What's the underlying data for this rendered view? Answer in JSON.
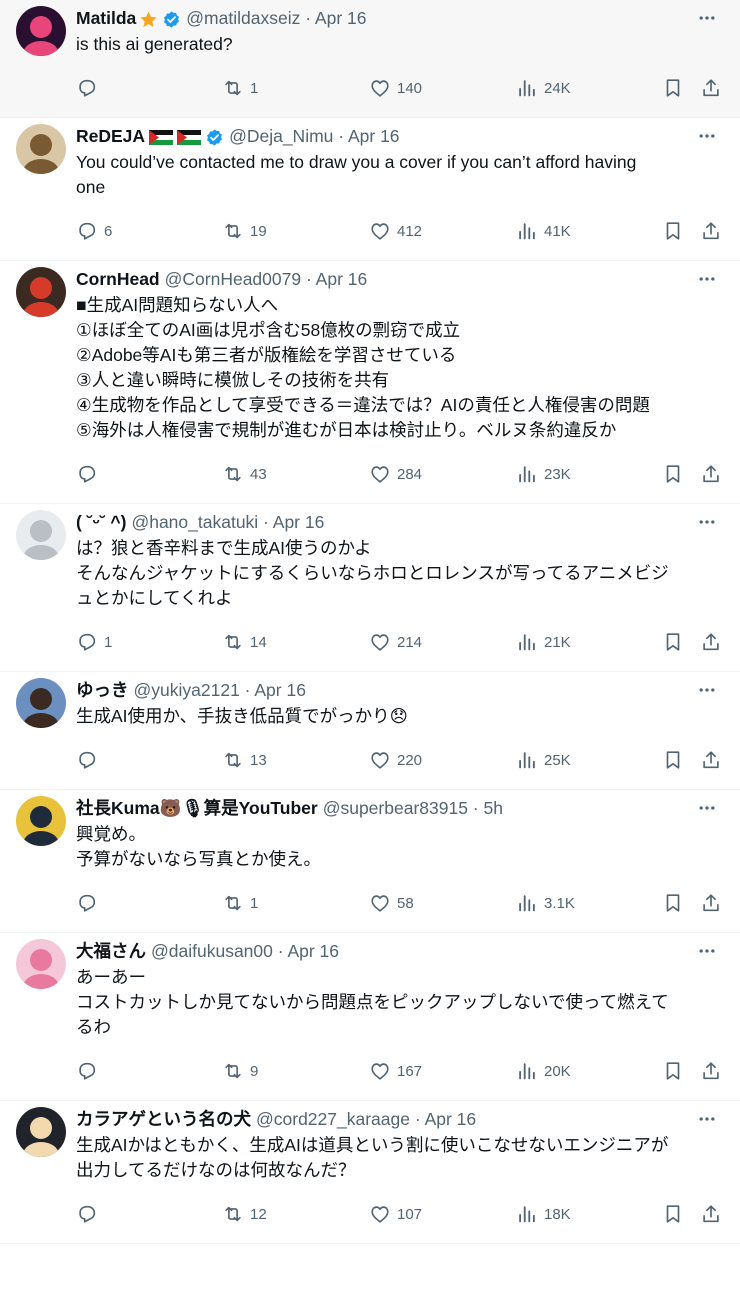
{
  "tweets": [
    {
      "name": "Matilda",
      "handle": "@matildaxseiz · Apr 16",
      "text": "is this ai generated?",
      "replies": "",
      "reposts": "1",
      "likes": "140",
      "views": "24K",
      "verified": true,
      "emoji": "star",
      "highlight": true,
      "avatar": {
        "bg": "#2a1030",
        "fg": "#e8467a"
      }
    },
    {
      "name": "ReDEJA",
      "handle": "@Deja_Nimu · Apr 16",
      "text": "You could’ve contacted me to draw you a cover if you can’t afford having\none",
      "replies": "6",
      "reposts": "19",
      "likes": "412",
      "views": "41K",
      "verified": true,
      "flags": [
        "palestine-flag",
        "sudan-flag"
      ],
      "avatar": {
        "bg": "#d8c6a4",
        "fg": "#7a5a33"
      }
    },
    {
      "name": "CornHead",
      "handle": "@CornHead0079 · Apr 16",
      "text": "■生成AI問題知らない人へ\n①ほぼ全てのAI画は児ポ含む58億枚の剽窃で成立\n②Adobe等AIも第三者が版権絵を学習させている\n③人と違い瞬時に模倣しその技術を共有\n④生成物を作品として享受できる＝違法では？AIの責任と人権侵害の問題\n⑤海外は人権侵害で規制が進むが日本は検討止り。ベルヌ条約違反か",
      "replies": "",
      "reposts": "43",
      "likes": "284",
      "views": "23K",
      "avatar": {
        "bg": "#3a2a22",
        "fg": "#d63a2a"
      }
    },
    {
      "name": "( ˘ᵕ˘ ^)",
      "handle": "@hano_takatuki · Apr 16",
      "text": "は？狼と香辛料まで生成AI使うのかよ\nそんなんジャケットにするくらいならホロとロレンスが写ってるアニメビジ\nュとかにしてくれよ",
      "replies": "1",
      "reposts": "14",
      "likes": "214",
      "views": "21K",
      "avatar": {
        "bg": "#e9ecee",
        "fg": "#b9bfc4"
      }
    },
    {
      "name": "ゆっき",
      "handle": "@yukiya2121 · Apr 16",
      "text": "生成AI使用か、手抜き低品質でがっかり😞",
      "replies": "",
      "reposts": "13",
      "likes": "220",
      "views": "25K",
      "avatar": {
        "bg": "#6b8fbf",
        "fg": "#3a2a22"
      }
    },
    {
      "name": "社長Kuma🐻🎙算是YouTuber",
      "handle": "@superbear83915 · 5h",
      "text": "興覚め。\n予算がないなら写真とか使え。",
      "replies": "",
      "reposts": "1",
      "likes": "58",
      "views": "3.1K",
      "avatar": {
        "bg": "#e7c23a",
        "fg": "#1f2b3a"
      }
    },
    {
      "name": "大福さん",
      "handle": "@daifukusan00 · Apr 16",
      "text": "あーあー\nコストカットしか見てないから問題点をピックアップしないで使って燃えて\nるわ",
      "replies": "",
      "reposts": "9",
      "likes": "167",
      "views": "20K",
      "avatar": {
        "bg": "#f4c8d8",
        "fg": "#e87aa0"
      }
    },
    {
      "name": "カラアゲという名の犬",
      "handle": "@cord227_karaage · Apr 16",
      "text": "生成AIかはともかく、生成AIは道具という割に使いこなせないエンジニアが\n出力してるだけなのは何故なんだ？",
      "replies": "",
      "reposts": "12",
      "likes": "107",
      "views": "18K",
      "avatar": {
        "bg": "#20242a",
        "fg": "#f2d9b0"
      }
    }
  ],
  "colors": {
    "text": "#0f1419",
    "secondary": "#536471",
    "verified": "#1d9bf0",
    "border": "#eff3f4",
    "highlight": "#f7f7f7",
    "star": "#f5a623"
  },
  "icons": [
    "reply-icon",
    "repost-icon",
    "like-icon",
    "views-icon",
    "bookmark-icon",
    "share-icon",
    "more-icon",
    "verified-badge-icon"
  ]
}
